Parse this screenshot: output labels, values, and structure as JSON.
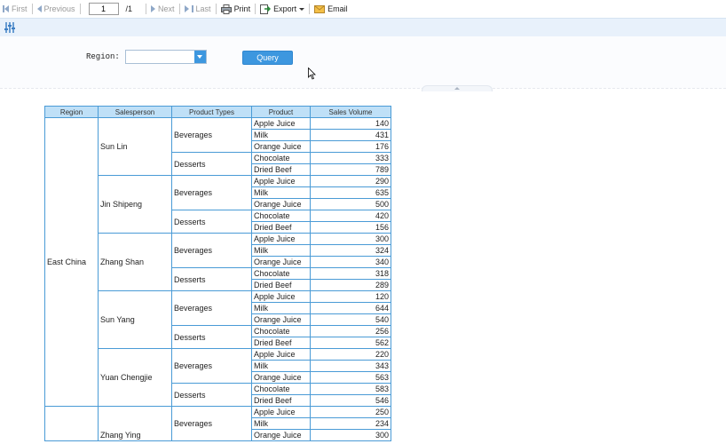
{
  "toolbar": {
    "first": "First",
    "previous": "Previous",
    "page_value": "1",
    "page_total": "/1",
    "next": "Next",
    "last": "Last",
    "print": "Print",
    "export": "Export",
    "email": "Email"
  },
  "params": {
    "region_label": "Region:",
    "region_value": "",
    "query_label": "Query"
  },
  "table": {
    "headers": [
      "Region",
      "Salesperson",
      "Product Types",
      "Product",
      "Sales Volume"
    ],
    "region": "East China",
    "groups": [
      {
        "salesperson": "Sun Lin",
        "types": [
          {
            "type": "Beverages",
            "items": [
              [
                "Apple Juice",
                "140"
              ],
              [
                "Milk",
                "431"
              ],
              [
                "Orange Juice",
                "176"
              ]
            ]
          },
          {
            "type": "Desserts",
            "items": [
              [
                "Chocolate",
                "333"
              ],
              [
                "Dried Beef",
                "789"
              ]
            ]
          }
        ]
      },
      {
        "salesperson": "Jin Shipeng",
        "types": [
          {
            "type": "Beverages",
            "items": [
              [
                "Apple Juice",
                "290"
              ],
              [
                "Milk",
                "635"
              ],
              [
                "Orange Juice",
                "500"
              ]
            ]
          },
          {
            "type": "Desserts",
            "items": [
              [
                "Chocolate",
                "420"
              ],
              [
                "Dried Beef",
                "156"
              ]
            ]
          }
        ]
      },
      {
        "salesperson": "Zhang Shan",
        "types": [
          {
            "type": "Beverages",
            "items": [
              [
                "Apple Juice",
                "300"
              ],
              [
                "Milk",
                "324"
              ],
              [
                "Orange Juice",
                "340"
              ]
            ]
          },
          {
            "type": "Desserts",
            "items": [
              [
                "Chocolate",
                "318"
              ],
              [
                "Dried Beef",
                "289"
              ]
            ]
          }
        ]
      },
      {
        "salesperson": "Sun Yang",
        "types": [
          {
            "type": "Beverages",
            "items": [
              [
                "Apple Juice",
                "120"
              ],
              [
                "Milk",
                "644"
              ],
              [
                "Orange Juice",
                "540"
              ]
            ]
          },
          {
            "type": "Desserts",
            "items": [
              [
                "Chocolate",
                "256"
              ],
              [
                "Dried Beef",
                "562"
              ]
            ]
          }
        ]
      },
      {
        "salesperson": "Yuan Chengjie",
        "types": [
          {
            "type": "Beverages",
            "items": [
              [
                "Apple Juice",
                "220"
              ],
              [
                "Milk",
                "343"
              ],
              [
                "Orange Juice",
                "563"
              ]
            ]
          },
          {
            "type": "Desserts",
            "items": [
              [
                "Chocolate",
                "583"
              ],
              [
                "Dried Beef",
                "546"
              ]
            ]
          }
        ]
      }
    ],
    "partial_group": {
      "salesperson": "Zhang Ying",
      "type": "Beverages",
      "items": [
        [
          "Apple Juice",
          "250"
        ],
        [
          "Milk",
          "234"
        ],
        [
          "Orange Juice",
          "300"
        ]
      ]
    }
  }
}
